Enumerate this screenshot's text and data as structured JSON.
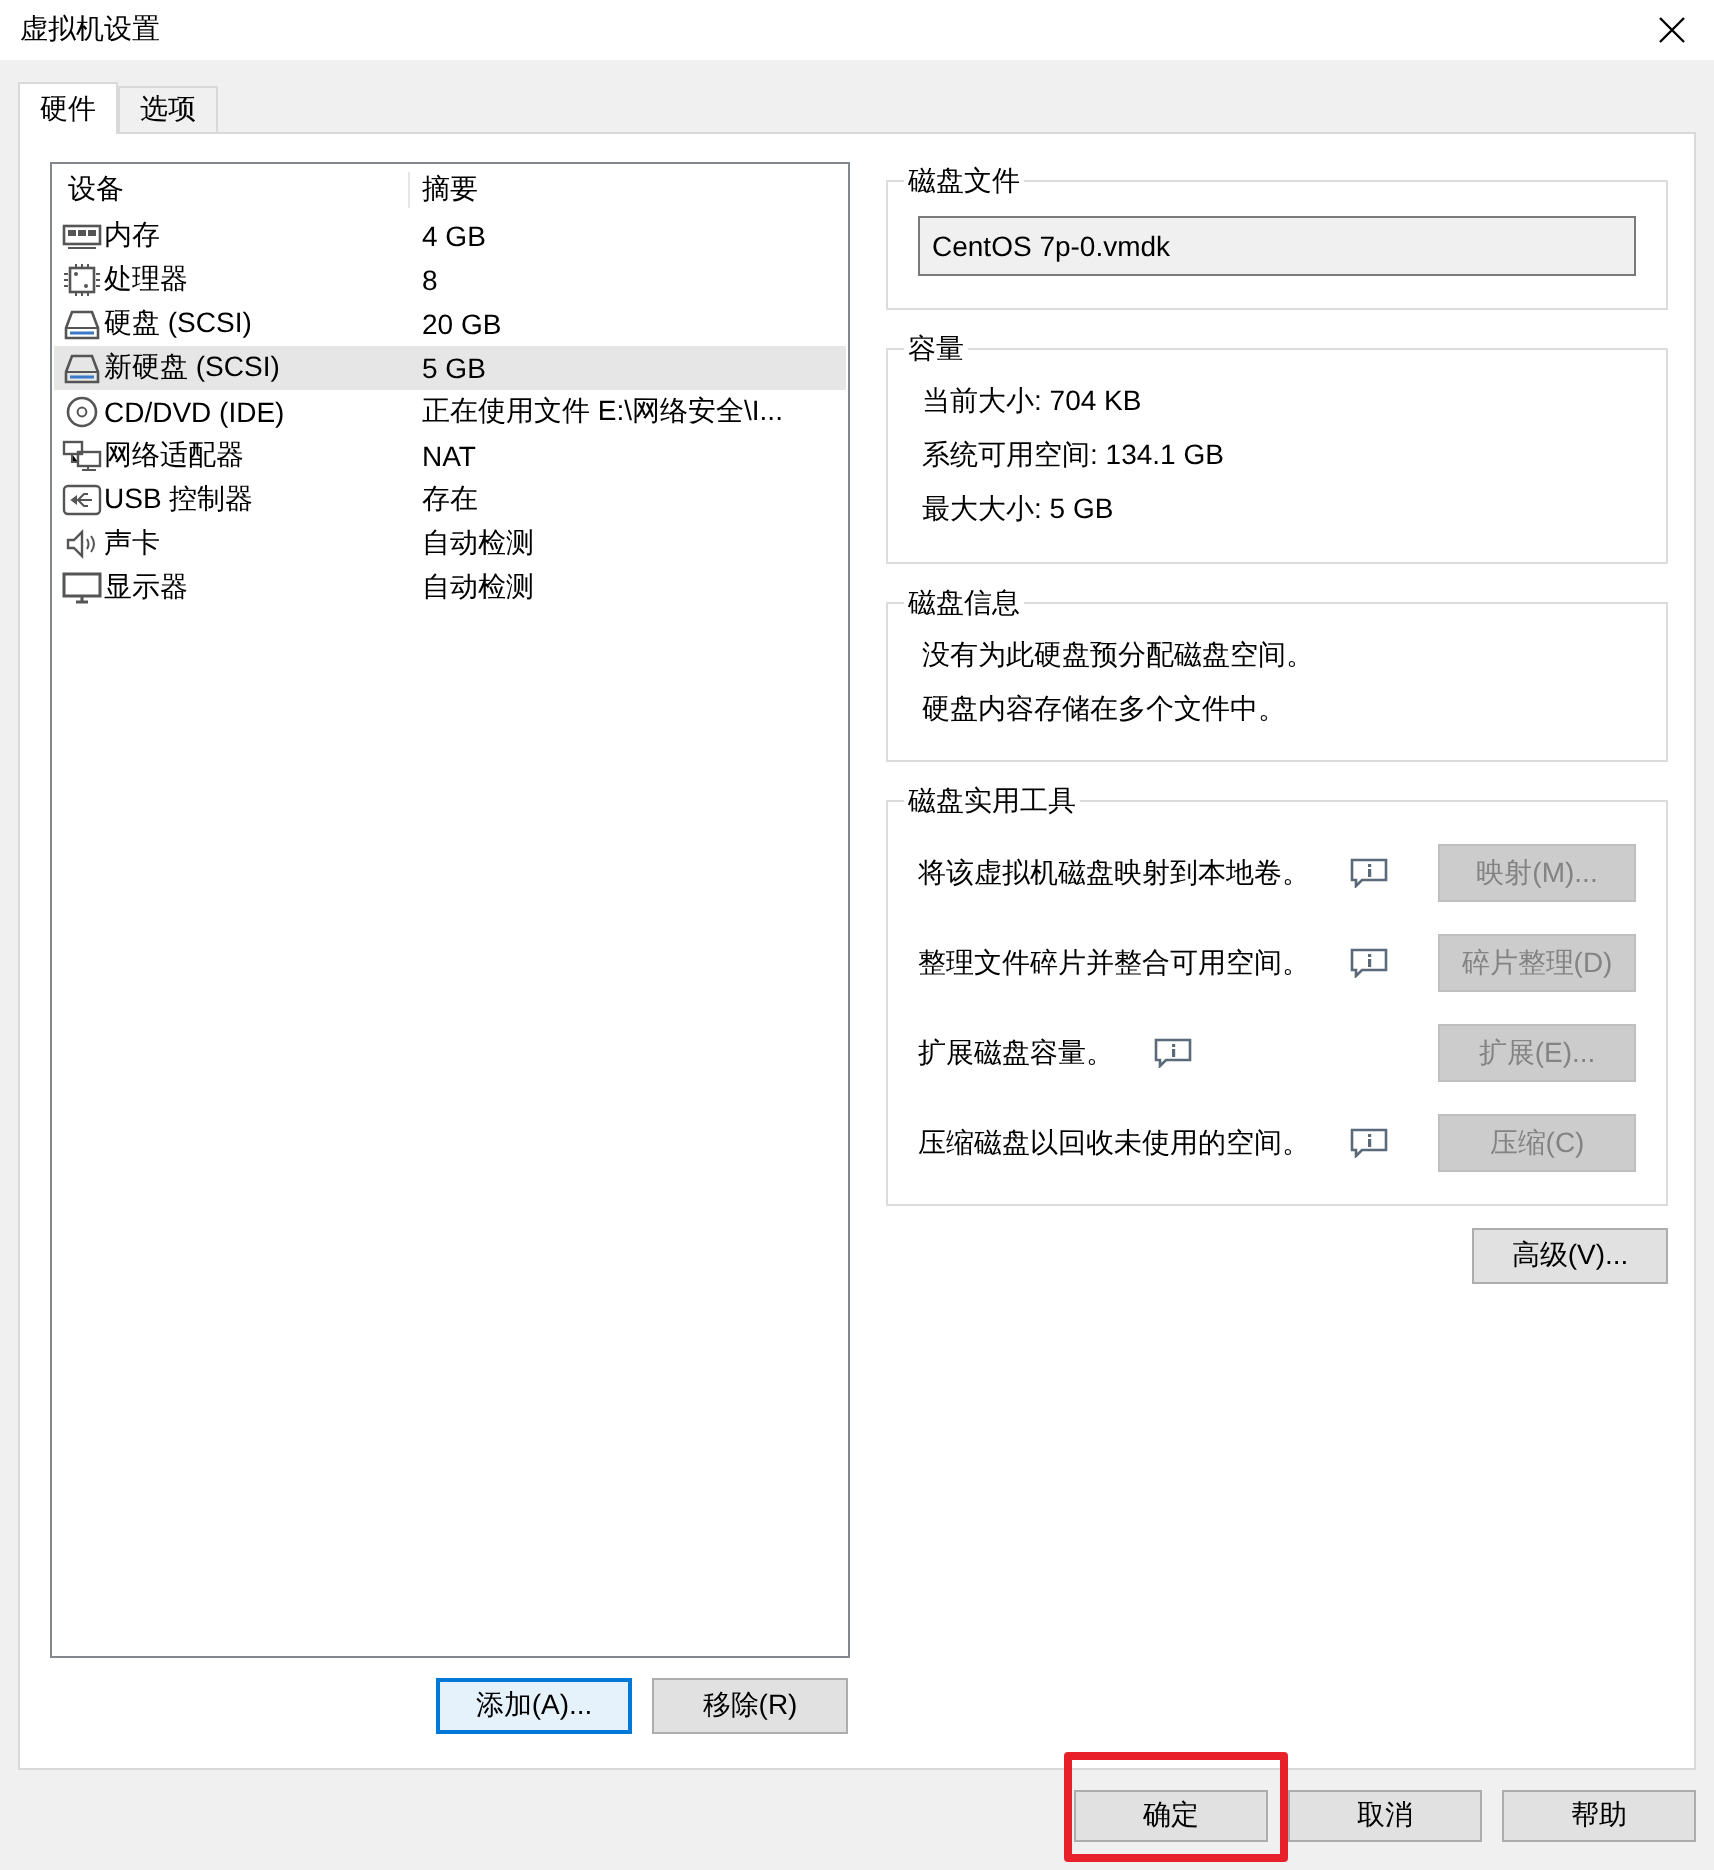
{
  "window": {
    "title": "虚拟机设置"
  },
  "tabs": [
    {
      "label": "硬件",
      "selected": true
    },
    {
      "label": "选项",
      "selected": false
    }
  ],
  "devices": {
    "columns": [
      "设备",
      "摘要"
    ],
    "rows": [
      {
        "kind": "memory",
        "name": "内存",
        "summary": "4 GB",
        "selected": false
      },
      {
        "kind": "cpu",
        "name": "处理器",
        "summary": "8",
        "selected": false
      },
      {
        "kind": "disk",
        "name": "硬盘 (SCSI)",
        "summary": "20 GB",
        "selected": false
      },
      {
        "kind": "disk",
        "name": "新硬盘 (SCSI)",
        "summary": "5 GB",
        "selected": true
      },
      {
        "kind": "cdrom",
        "name": "CD/DVD (IDE)",
        "summary": "正在使用文件 E:\\网络安全\\I...",
        "selected": false
      },
      {
        "kind": "network",
        "name": "网络适配器",
        "summary": "NAT",
        "selected": false
      },
      {
        "kind": "usb",
        "name": "USB 控制器",
        "summary": "存在",
        "selected": false
      },
      {
        "kind": "sound",
        "name": "声卡",
        "summary": "自动检测",
        "selected": false
      },
      {
        "kind": "display",
        "name": "显示器",
        "summary": "自动检测",
        "selected": false
      }
    ]
  },
  "device_buttons": [
    {
      "label": "添加(A)...",
      "focused": true
    },
    {
      "label": "移除(R)",
      "focused": false
    }
  ],
  "disk_file": {
    "title": "磁盘文件",
    "value": "CentOS 7p-0.vmdk"
  },
  "capacity": {
    "title": "容量",
    "lines": [
      "当前大小: 704 KB",
      "系统可用空间: 134.1 GB",
      "最大大小: 5 GB"
    ]
  },
  "disk_info": {
    "title": "磁盘信息",
    "lines": [
      "没有为此硬盘预分配磁盘空间。",
      "硬盘内容存储在多个文件中。"
    ]
  },
  "disk_utilities": {
    "title": "磁盘实用工具",
    "items": [
      {
        "text": "将该虚拟机磁盘映射到本地卷。",
        "button": "映射(M)...",
        "disabled": true
      },
      {
        "text": "整理文件碎片并整合可用空间。",
        "button": "碎片整理(D)",
        "disabled": true
      },
      {
        "text": "扩展磁盘容量。",
        "button": "扩展(E)...",
        "disabled": true
      },
      {
        "text": "压缩磁盘以回收未使用的空间。",
        "button": "压缩(C)",
        "disabled": true
      }
    ]
  },
  "advanced_button": {
    "label": "高级(V)..."
  },
  "dialog_buttons": [
    {
      "label": "确定",
      "highlighted": true
    },
    {
      "label": "取消",
      "highlighted": false
    },
    {
      "label": "帮助",
      "highlighted": false
    }
  ]
}
